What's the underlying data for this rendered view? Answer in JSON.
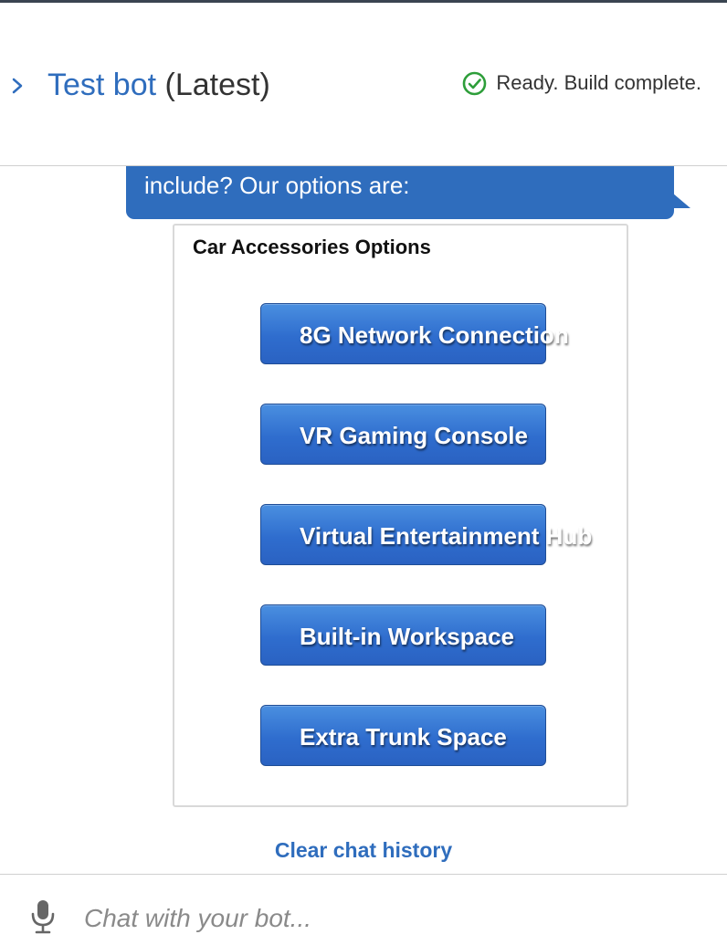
{
  "header": {
    "title_link": "Test bot",
    "title_version": "(Latest)",
    "status_text": "Ready. Build complete.",
    "status_icon": "check-circle-icon",
    "status_color": "#2e9e3a"
  },
  "conversation": {
    "bot_message": "include? Our options are:",
    "card": {
      "title": "Car Accessories Options",
      "buttons": [
        {
          "label": "8G Network Connection"
        },
        {
          "label": "VR Gaming Console"
        },
        {
          "label": "Virtual Entertainment Hub"
        },
        {
          "label": "Built-in Workspace"
        },
        {
          "label": "Extra Trunk Space"
        }
      ]
    },
    "clear_history": "Clear chat history"
  },
  "input": {
    "placeholder": "Chat with your bot...",
    "value": "",
    "mic_icon": "microphone-icon"
  },
  "colors": {
    "accent": "#2f6dbd",
    "button": "#2f6dce",
    "text": "#333333"
  }
}
